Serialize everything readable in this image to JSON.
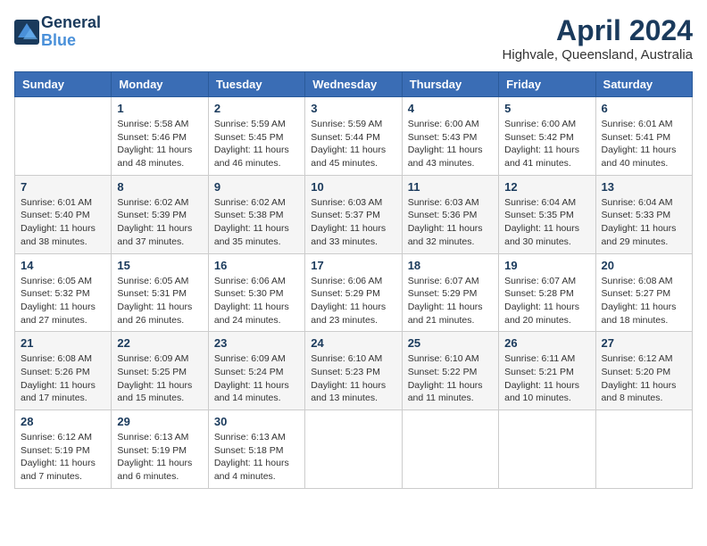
{
  "logo": {
    "line1": "General",
    "line2": "Blue"
  },
  "title": "April 2024",
  "subtitle": "Highvale, Queensland, Australia",
  "headers": [
    "Sunday",
    "Monday",
    "Tuesday",
    "Wednesday",
    "Thursday",
    "Friday",
    "Saturday"
  ],
  "weeks": [
    [
      {
        "day": "",
        "sunrise": "",
        "sunset": "",
        "daylight": ""
      },
      {
        "day": "1",
        "sunrise": "Sunrise: 5:58 AM",
        "sunset": "Sunset: 5:46 PM",
        "daylight": "Daylight: 11 hours and 48 minutes."
      },
      {
        "day": "2",
        "sunrise": "Sunrise: 5:59 AM",
        "sunset": "Sunset: 5:45 PM",
        "daylight": "Daylight: 11 hours and 46 minutes."
      },
      {
        "day": "3",
        "sunrise": "Sunrise: 5:59 AM",
        "sunset": "Sunset: 5:44 PM",
        "daylight": "Daylight: 11 hours and 45 minutes."
      },
      {
        "day": "4",
        "sunrise": "Sunrise: 6:00 AM",
        "sunset": "Sunset: 5:43 PM",
        "daylight": "Daylight: 11 hours and 43 minutes."
      },
      {
        "day": "5",
        "sunrise": "Sunrise: 6:00 AM",
        "sunset": "Sunset: 5:42 PM",
        "daylight": "Daylight: 11 hours and 41 minutes."
      },
      {
        "day": "6",
        "sunrise": "Sunrise: 6:01 AM",
        "sunset": "Sunset: 5:41 PM",
        "daylight": "Daylight: 11 hours and 40 minutes."
      }
    ],
    [
      {
        "day": "7",
        "sunrise": "Sunrise: 6:01 AM",
        "sunset": "Sunset: 5:40 PM",
        "daylight": "Daylight: 11 hours and 38 minutes."
      },
      {
        "day": "8",
        "sunrise": "Sunrise: 6:02 AM",
        "sunset": "Sunset: 5:39 PM",
        "daylight": "Daylight: 11 hours and 37 minutes."
      },
      {
        "day": "9",
        "sunrise": "Sunrise: 6:02 AM",
        "sunset": "Sunset: 5:38 PM",
        "daylight": "Daylight: 11 hours and 35 minutes."
      },
      {
        "day": "10",
        "sunrise": "Sunrise: 6:03 AM",
        "sunset": "Sunset: 5:37 PM",
        "daylight": "Daylight: 11 hours and 33 minutes."
      },
      {
        "day": "11",
        "sunrise": "Sunrise: 6:03 AM",
        "sunset": "Sunset: 5:36 PM",
        "daylight": "Daylight: 11 hours and 32 minutes."
      },
      {
        "day": "12",
        "sunrise": "Sunrise: 6:04 AM",
        "sunset": "Sunset: 5:35 PM",
        "daylight": "Daylight: 11 hours and 30 minutes."
      },
      {
        "day": "13",
        "sunrise": "Sunrise: 6:04 AM",
        "sunset": "Sunset: 5:33 PM",
        "daylight": "Daylight: 11 hours and 29 minutes."
      }
    ],
    [
      {
        "day": "14",
        "sunrise": "Sunrise: 6:05 AM",
        "sunset": "Sunset: 5:32 PM",
        "daylight": "Daylight: 11 hours and 27 minutes."
      },
      {
        "day": "15",
        "sunrise": "Sunrise: 6:05 AM",
        "sunset": "Sunset: 5:31 PM",
        "daylight": "Daylight: 11 hours and 26 minutes."
      },
      {
        "day": "16",
        "sunrise": "Sunrise: 6:06 AM",
        "sunset": "Sunset: 5:30 PM",
        "daylight": "Daylight: 11 hours and 24 minutes."
      },
      {
        "day": "17",
        "sunrise": "Sunrise: 6:06 AM",
        "sunset": "Sunset: 5:29 PM",
        "daylight": "Daylight: 11 hours and 23 minutes."
      },
      {
        "day": "18",
        "sunrise": "Sunrise: 6:07 AM",
        "sunset": "Sunset: 5:29 PM",
        "daylight": "Daylight: 11 hours and 21 minutes."
      },
      {
        "day": "19",
        "sunrise": "Sunrise: 6:07 AM",
        "sunset": "Sunset: 5:28 PM",
        "daylight": "Daylight: 11 hours and 20 minutes."
      },
      {
        "day": "20",
        "sunrise": "Sunrise: 6:08 AM",
        "sunset": "Sunset: 5:27 PM",
        "daylight": "Daylight: 11 hours and 18 minutes."
      }
    ],
    [
      {
        "day": "21",
        "sunrise": "Sunrise: 6:08 AM",
        "sunset": "Sunset: 5:26 PM",
        "daylight": "Daylight: 11 hours and 17 minutes."
      },
      {
        "day": "22",
        "sunrise": "Sunrise: 6:09 AM",
        "sunset": "Sunset: 5:25 PM",
        "daylight": "Daylight: 11 hours and 15 minutes."
      },
      {
        "day": "23",
        "sunrise": "Sunrise: 6:09 AM",
        "sunset": "Sunset: 5:24 PM",
        "daylight": "Daylight: 11 hours and 14 minutes."
      },
      {
        "day": "24",
        "sunrise": "Sunrise: 6:10 AM",
        "sunset": "Sunset: 5:23 PM",
        "daylight": "Daylight: 11 hours and 13 minutes."
      },
      {
        "day": "25",
        "sunrise": "Sunrise: 6:10 AM",
        "sunset": "Sunset: 5:22 PM",
        "daylight": "Daylight: 11 hours and 11 minutes."
      },
      {
        "day": "26",
        "sunrise": "Sunrise: 6:11 AM",
        "sunset": "Sunset: 5:21 PM",
        "daylight": "Daylight: 11 hours and 10 minutes."
      },
      {
        "day": "27",
        "sunrise": "Sunrise: 6:12 AM",
        "sunset": "Sunset: 5:20 PM",
        "daylight": "Daylight: 11 hours and 8 minutes."
      }
    ],
    [
      {
        "day": "28",
        "sunrise": "Sunrise: 6:12 AM",
        "sunset": "Sunset: 5:19 PM",
        "daylight": "Daylight: 11 hours and 7 minutes."
      },
      {
        "day": "29",
        "sunrise": "Sunrise: 6:13 AM",
        "sunset": "Sunset: 5:19 PM",
        "daylight": "Daylight: 11 hours and 6 minutes."
      },
      {
        "day": "30",
        "sunrise": "Sunrise: 6:13 AM",
        "sunset": "Sunset: 5:18 PM",
        "daylight": "Daylight: 11 hours and 4 minutes."
      },
      {
        "day": "",
        "sunrise": "",
        "sunset": "",
        "daylight": ""
      },
      {
        "day": "",
        "sunrise": "",
        "sunset": "",
        "daylight": ""
      },
      {
        "day": "",
        "sunrise": "",
        "sunset": "",
        "daylight": ""
      },
      {
        "day": "",
        "sunrise": "",
        "sunset": "",
        "daylight": ""
      }
    ]
  ]
}
